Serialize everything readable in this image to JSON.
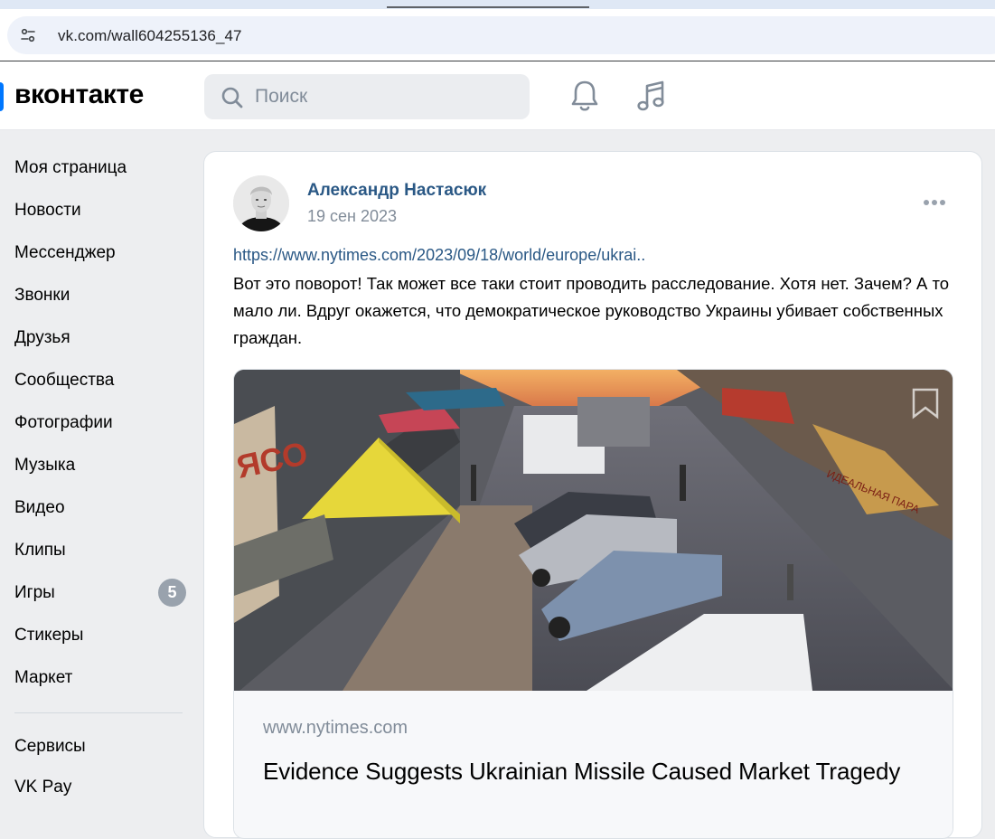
{
  "browser": {
    "url": "vk.com/wall604255136_47"
  },
  "header": {
    "logo_text": "вконтакте",
    "search_placeholder": "Поиск",
    "accent_color": "#0077ff"
  },
  "sidebar": {
    "items": [
      {
        "label": "Моя страница",
        "icon": "none"
      },
      {
        "label": "Новости"
      },
      {
        "label": "Мессенджер"
      },
      {
        "label": "Звонки"
      },
      {
        "label": "Друзья"
      },
      {
        "label": "Сообщества"
      },
      {
        "label": "Фотографии"
      },
      {
        "label": "Музыка"
      },
      {
        "label": "Видео"
      },
      {
        "label": "Клипы"
      },
      {
        "label": "Игры",
        "badge": "5"
      },
      {
        "label": "Стикеры"
      },
      {
        "label": "Маркет"
      }
    ],
    "extra_items": [
      {
        "label": "Сервисы"
      },
      {
        "label": "VK Pay"
      }
    ]
  },
  "post": {
    "author": "Александр Настасюк",
    "date": "19 сен 2023",
    "link_text": "https://www.nytimes.com/2023/09/18/world/europe/ukrai..",
    "text": "Вот это поворот! Так может все таки стоит проводить расследование. Хотя нет. Зачем? А то мало ли. Вдруг окажется, что демократическое руководство Украины убивает собственных граждан.",
    "attachment": {
      "domain": "www.nytimes.com",
      "title": "Evidence Suggests Ukrainian Missile Caused Market Tragedy"
    }
  }
}
